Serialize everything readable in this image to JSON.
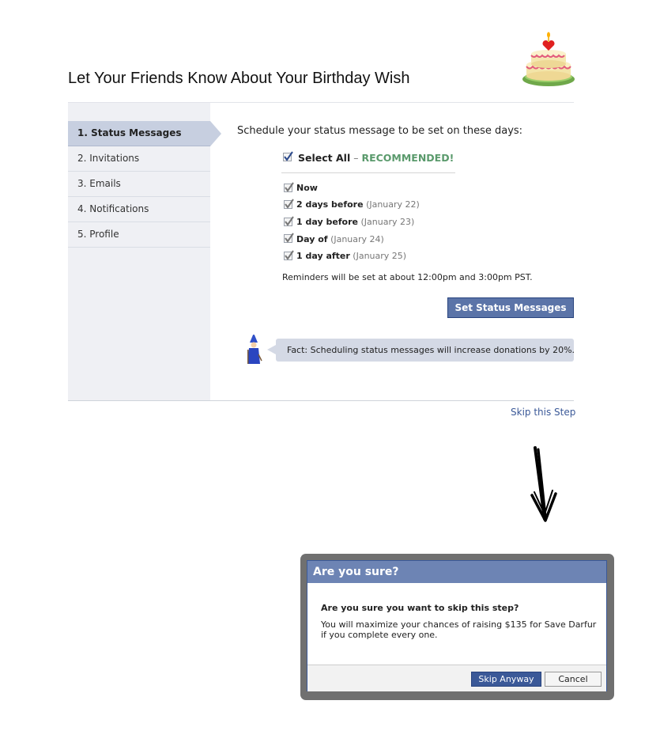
{
  "page": {
    "title": "Let Your Friends Know About Your Birthday Wish"
  },
  "sidebar": {
    "items": [
      {
        "label": "1. Status Messages",
        "active": true
      },
      {
        "label": "2. Invitations",
        "active": false
      },
      {
        "label": "3. Emails",
        "active": false
      },
      {
        "label": "4. Notifications",
        "active": false
      },
      {
        "label": "5. Profile",
        "active": false
      }
    ]
  },
  "main": {
    "schedule_text": "Schedule your status message to be set on these days:",
    "select_all": {
      "label": "Select All",
      "separator": " – ",
      "recommended": "RECOMMENDED!",
      "checked": true
    },
    "options": [
      {
        "label": "Now",
        "date": "",
        "checked": true
      },
      {
        "label": "2 days before",
        "date": "(January 22)",
        "checked": true
      },
      {
        "label": "1 day before",
        "date": "(January 23)",
        "checked": true
      },
      {
        "label": "Day of",
        "date": "(January 24)",
        "checked": true
      },
      {
        "label": "1 day after",
        "date": "(January 25)",
        "checked": true
      }
    ],
    "reminder_text": "Reminders will be set at about 12:00pm and 3:00pm PST.",
    "set_button_label": "Set Status Messages",
    "fact_text": "Fact: Scheduling status messages will increase donations by 20%.",
    "skip_link": "Skip this Step"
  },
  "dialog": {
    "title": "Are you sure?",
    "question": "Are you sure you want to skip this step?",
    "body": "You will maximize your chances of raising $135 for Save Darfur if you complete every one.",
    "skip_button": "Skip Anyway",
    "cancel_button": "Cancel"
  },
  "icons": {
    "cake": "birthday-cake-icon",
    "wizard": "wizard-icon",
    "arrow": "arrow-down-icon",
    "checkbox": "checkmark-icon"
  },
  "colors": {
    "brand": "#3b5998",
    "dialog_header": "#6d84b4",
    "recommended": "#5a9a6c",
    "fact_bg": "#d4d9e5"
  }
}
